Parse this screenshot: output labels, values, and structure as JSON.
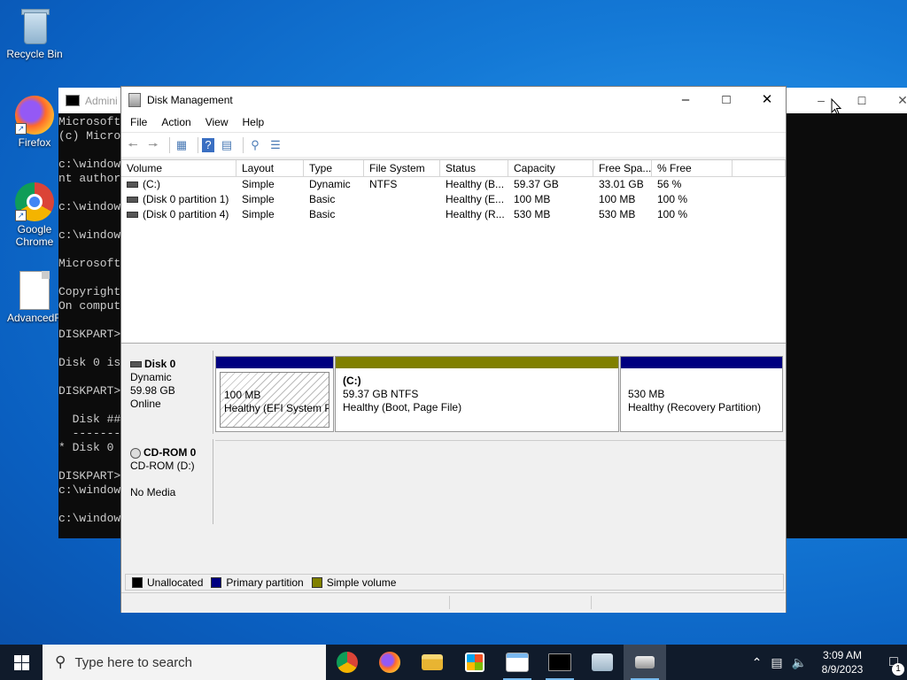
{
  "desktop": {
    "icons": [
      {
        "label": "Recycle Bin"
      },
      {
        "label": "Firefox"
      },
      {
        "label": "Google Chrome"
      },
      {
        "label": "AdvancedR"
      }
    ]
  },
  "cmd": {
    "title": "Admini",
    "lines": [
      "Microsoft",
      "(c) Micro",
      "",
      "c:\\window",
      "nt author",
      "",
      "c:\\window",
      "",
      "c:\\window",
      "",
      "Microsoft",
      "",
      "Copyright",
      "On comput",
      "",
      "DISKPART>",
      "",
      "Disk 0 is",
      "",
      "DISKPART>",
      "",
      "  Disk ##",
      "  -------",
      "* Disk 0",
      "",
      "DISKPART>",
      "c:\\window",
      "",
      "c:\\window"
    ]
  },
  "disk_management": {
    "title": "Disk Management",
    "menu": [
      "File",
      "Action",
      "View",
      "Help"
    ],
    "columns": [
      "Volume",
      "Layout",
      "Type",
      "File System",
      "Status",
      "Capacity",
      "Free Spa...",
      "% Free",
      ""
    ],
    "volumes": [
      {
        "volume": "(C:)",
        "layout": "Simple",
        "type": "Dynamic",
        "fs": "NTFS",
        "status": "Healthy (B...",
        "capacity": "59.37 GB",
        "free": "33.01 GB",
        "pct": "56 %"
      },
      {
        "volume": "(Disk 0 partition 1)",
        "layout": "Simple",
        "type": "Basic",
        "fs": "",
        "status": "Healthy (E...",
        "capacity": "100 MB",
        "free": "100 MB",
        "pct": "100 %"
      },
      {
        "volume": "(Disk 0 partition 4)",
        "layout": "Simple",
        "type": "Basic",
        "fs": "",
        "status": "Healthy (R...",
        "capacity": "530 MB",
        "free": "530 MB",
        "pct": "100 %"
      }
    ],
    "disk0": {
      "name": "Disk 0",
      "type": "Dynamic",
      "size": "59.98 GB",
      "state": "Online",
      "partitions": [
        {
          "name": "",
          "size": "100 MB",
          "status": "Healthy (EFI System Pa"
        },
        {
          "name": "(C:)",
          "size": "59.37 GB NTFS",
          "status": "Healthy (Boot, Page File)"
        },
        {
          "name": "",
          "size": "530 MB",
          "status": "Healthy (Recovery Partition)"
        }
      ]
    },
    "cdrom0": {
      "name": "CD-ROM 0",
      "drive": "CD-ROM (D:)",
      "media": "No Media"
    },
    "legend": [
      {
        "label": "Unallocated",
        "color": "#000000"
      },
      {
        "label": "Primary partition",
        "color": "#000080"
      },
      {
        "label": "Simple volume",
        "color": "#808000"
      }
    ]
  },
  "colors": {
    "primary_partition": "#000080",
    "simple_volume": "#808000",
    "taskbar": "#101b2b"
  },
  "taskbar": {
    "search_placeholder": "Type here to search",
    "time": "3:09 AM",
    "date": "8/9/2023",
    "notification_count": "1",
    "apps": [
      "chrome-icon",
      "firefox-icon",
      "file-explorer-icon",
      "store-icon",
      "notepad-icon",
      "cmd-icon",
      "performance-icon",
      "disk-management-icon"
    ]
  }
}
